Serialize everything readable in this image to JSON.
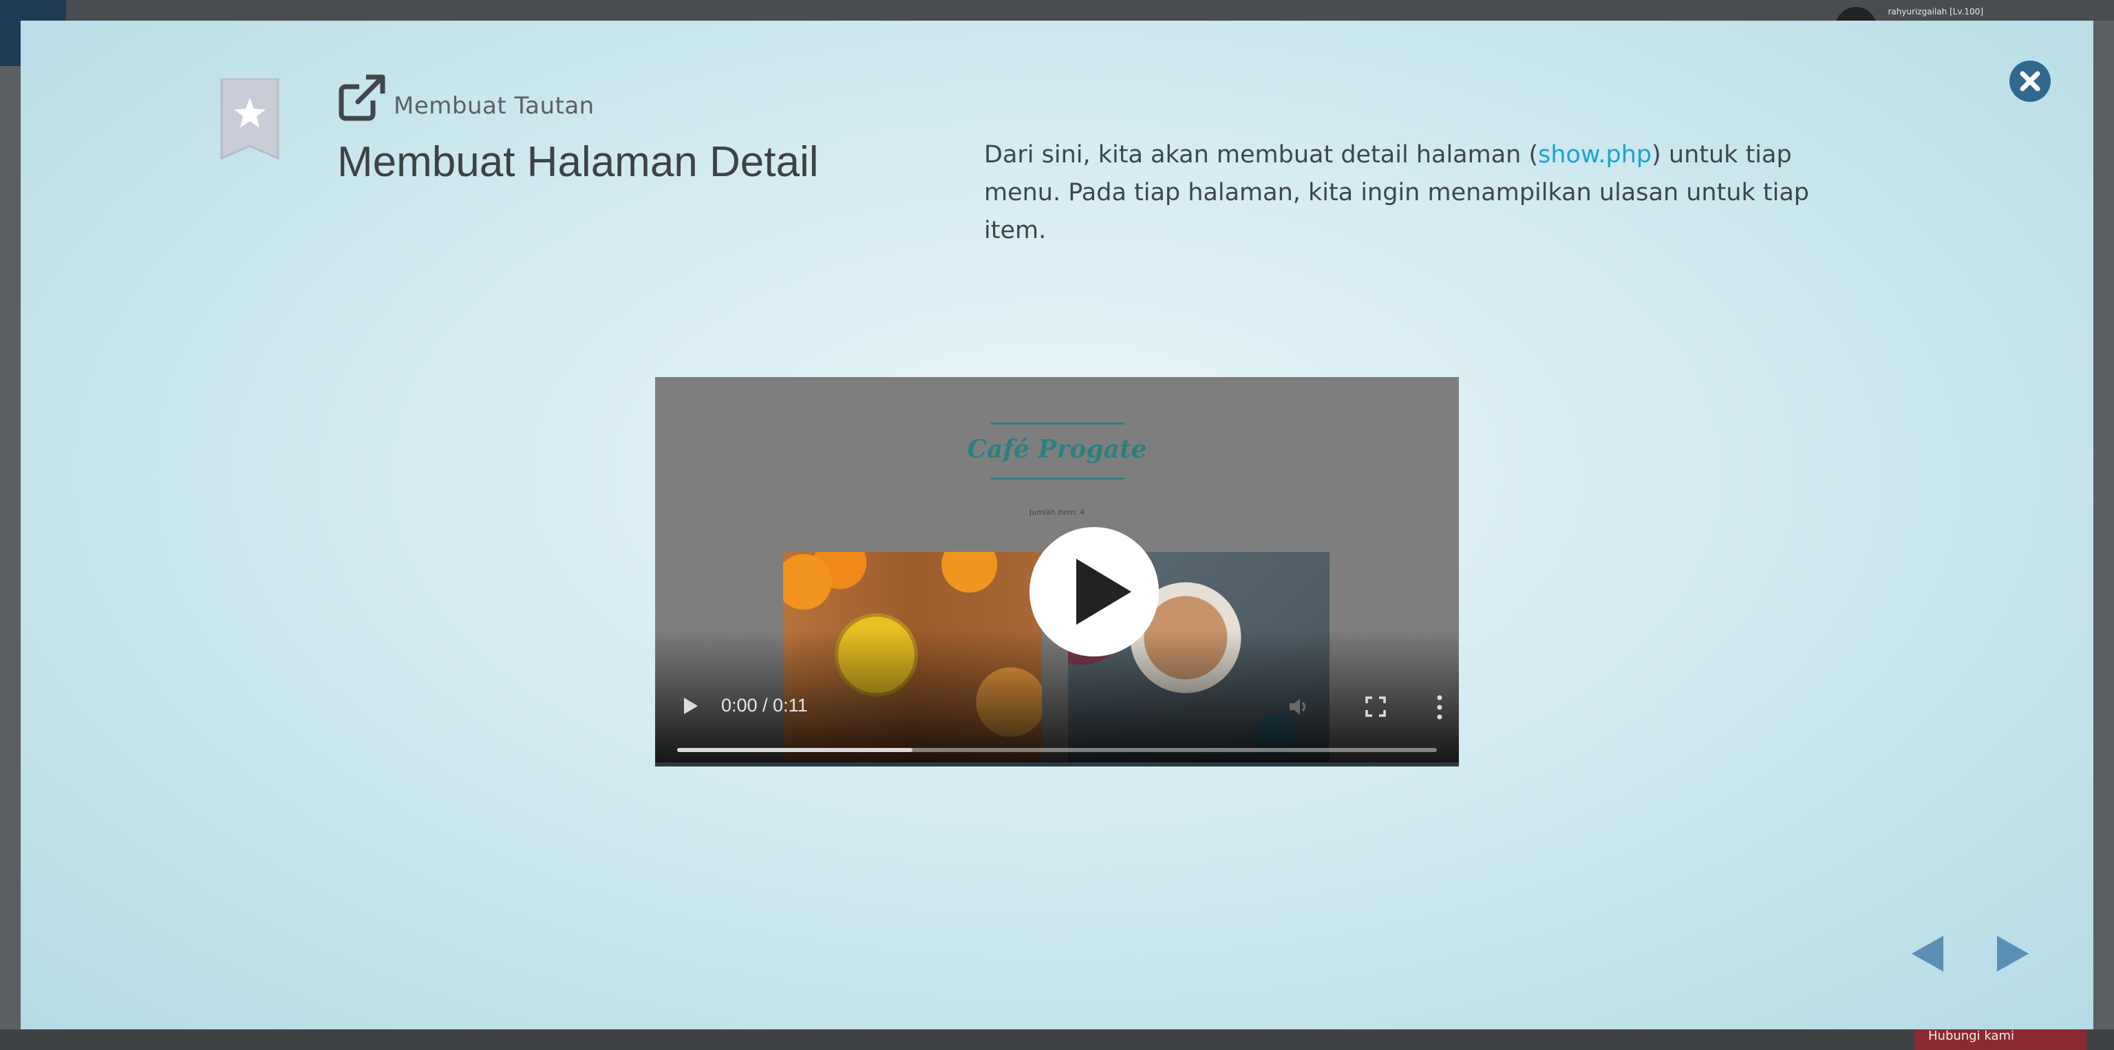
{
  "background": {
    "user_name": "rahyurizgailah [Lv.100]",
    "bottom_button_label": "Hubungi kami"
  },
  "modal": {
    "link_label": "Membuat Tautan",
    "title": "Membuat Halaman Detail",
    "description": {
      "part1": "Dari sini, kita akan membuat detail halaman (",
      "link": "show.php",
      "part2": ") untuk tiap menu. Pada tiap halaman, kita ingin menampilkan ulasan untuk tiap item."
    },
    "colors": {
      "accent": "#1aa3d4",
      "close_button": "#2f6990",
      "nav_arrow": "#5b8fb3"
    }
  },
  "video": {
    "preview_brand": "Café Progate",
    "preview_items": "Jumlah item: 4",
    "time_label": "0:00 / 0:11",
    "progress_fraction": 0.31
  },
  "icons": {
    "bookmark": "bookmark-star-icon",
    "link": "external-link-icon",
    "close": "close-icon",
    "prev": "prev-arrow-icon",
    "next": "next-arrow-icon"
  }
}
